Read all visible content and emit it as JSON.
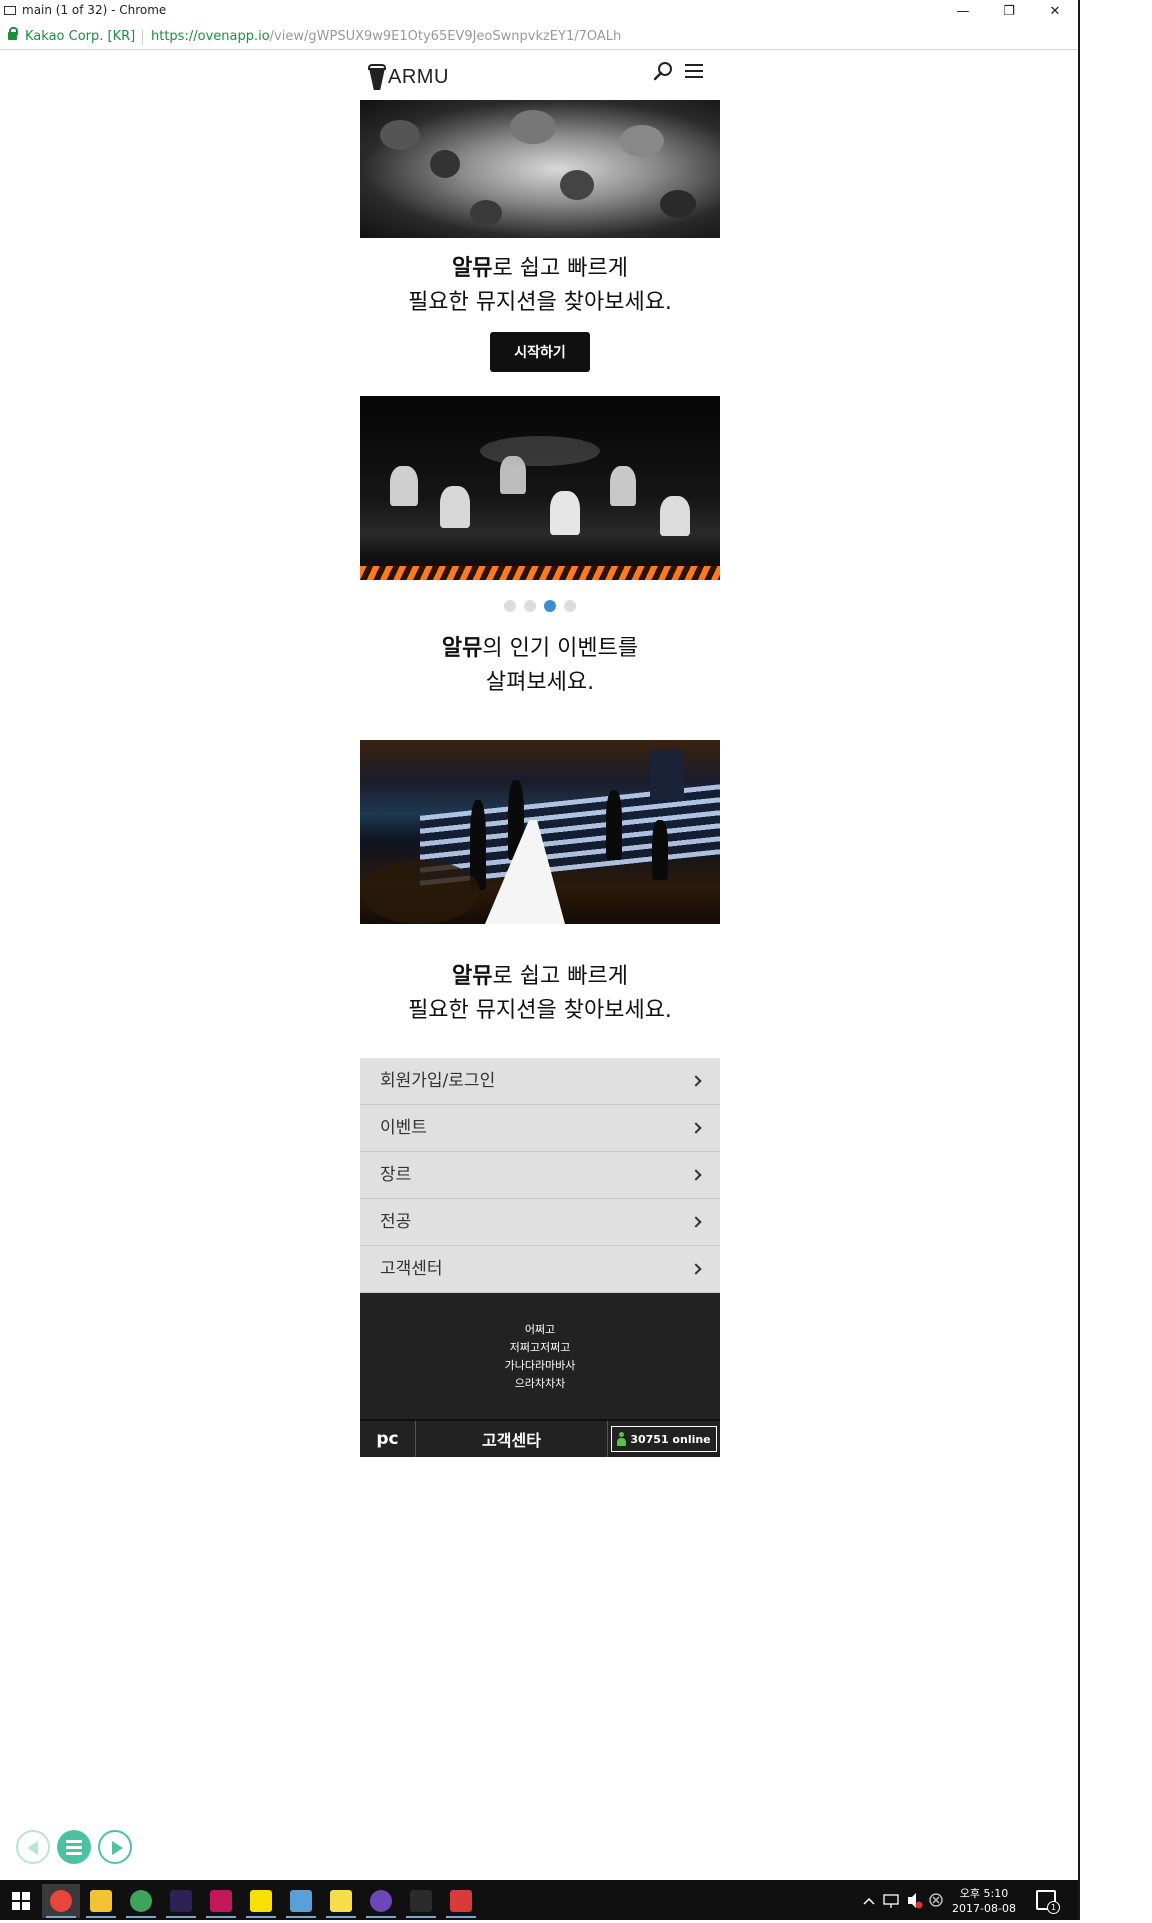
{
  "window": {
    "title": "main (1 of 32) - Chrome",
    "minimize_glyph": "—",
    "restore_glyph": "❐",
    "close_glyph": "✕"
  },
  "addressbar": {
    "origin": "Kakao Corp. [KR]",
    "url_scheme": "https://",
    "url_host": "ovenapp.io",
    "url_path": "/view/gWPSUX9w9E1Oty65EV9JeoSwnpvkzEY1/7OALh"
  },
  "header": {
    "logo_text": "ARMU",
    "search_icon": "search-icon",
    "menu_icon": "hamburger-menu-icon"
  },
  "section1": {
    "headline_bold": "알뮤",
    "headline_rest": "로 쉽고 빠르게",
    "headline_line2": "필요한 뮤지션을 찾아보세요.",
    "button_label": "시작하기"
  },
  "carousel": {
    "dot_count": 4,
    "active_index": 2,
    "accent_color": "#3a8fd0"
  },
  "section2": {
    "headline_bold": "알뮤",
    "headline_rest": "의 인기 이벤트를",
    "headline_line2": "살펴보세요."
  },
  "section3": {
    "headline_bold": "알뮤",
    "headline_rest": "로 쉽고 빠르게",
    "headline_line2": "필요한 뮤지션을 찾아보세요."
  },
  "menu_list": {
    "items": [
      {
        "label": "회원가입/로그인"
      },
      {
        "label": "이벤트"
      },
      {
        "label": "장르"
      },
      {
        "label": "전공"
      },
      {
        "label": "고객센터"
      }
    ]
  },
  "footer": {
    "info_lines": [
      "어쩌고",
      "저쩌고저쩌고",
      "가나다라마바사",
      "으라차차차"
    ],
    "pc_label": "pc",
    "cs_label": "고객센타",
    "online_text": "30751 online",
    "online_color": "#58c24b"
  },
  "slide_controls": {
    "prev_icon": "prev-slide-icon",
    "menu_icon": "slide-menu-icon",
    "next_icon": "next-slide-icon",
    "accent": "#4cc2a2"
  },
  "taskbar": {
    "apps": [
      {
        "name": "chrome-icon",
        "color": "#e8453c"
      },
      {
        "name": "file-explorer-icon",
        "color": "#f3c232"
      },
      {
        "name": "green-globe-icon",
        "color": "#3ba55c"
      },
      {
        "name": "eclipse-icon",
        "color": "#2c2255"
      },
      {
        "name": "intellij-icon",
        "color": "#c2185b"
      },
      {
        "name": "kakaotalk-icon",
        "color": "#f9e000"
      },
      {
        "name": "pencil-app-icon",
        "color": "#5aa0d8"
      },
      {
        "name": "sticky-notes-icon",
        "color": "#f7dd4a"
      },
      {
        "name": "purple-app-icon",
        "color": "#6b47b8"
      },
      {
        "name": "terminal-icon",
        "color": "#2b2b2b"
      },
      {
        "name": "notepad-icon",
        "color": "#d93a3a"
      }
    ],
    "clock_period": "오후 5:10",
    "clock_date": "2017-08-08",
    "notification_count": "1"
  }
}
